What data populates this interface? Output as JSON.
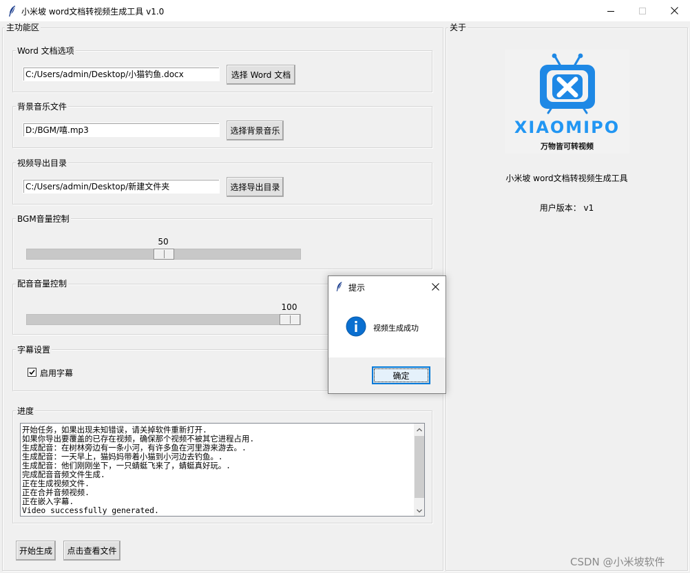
{
  "window": {
    "title": "小米坡 word文档转视频生成工具 v1.0",
    "icon": "feather-icon"
  },
  "main_panel": {
    "label": "主功能区",
    "word_section": {
      "label": "Word 文档选项",
      "path": "C:/Users/admin/Desktop/小猫钓鱼.docx",
      "button": "选择 Word 文档"
    },
    "bgm_section": {
      "label": "背景音乐文件",
      "path": "D:/BGM/嘻.mp3",
      "button": "选择背景音乐"
    },
    "output_section": {
      "label": "视频导出目录",
      "path": "C:/Users/admin/Desktop/新建文件夹",
      "button": "选择导出目录"
    },
    "bgm_volume": {
      "label": "BGM音量控制",
      "value": 50,
      "value_text": "50",
      "min": 0,
      "max": 100
    },
    "voice_volume": {
      "label": "配音音量控制",
      "value": 100,
      "value_text": "100",
      "min": 0,
      "max": 100
    },
    "subtitle_section": {
      "label": "字幕设置",
      "checkbox_label": "启用字幕",
      "checked": true
    },
    "progress_section": {
      "label": "进度",
      "lines": [
        "开始任务，如果出现未知错误，请关掉软件重新打开.",
        "如果你导出要覆盖的已存在视频，确保那个视频不被其它进程占用.",
        "生成配音：在树林旁边有一条小河，有许多鱼在河里游来游去。.",
        "生成配音：一天早上，猫妈妈带着小猫到小河边去钓鱼。.",
        "生成配音：他们刚刚坐下，一只蜻蜓飞来了，蜻蜓真好玩。.",
        "完成配音音频文件生成.",
        "正在生成视频文件.",
        "正在合并音频视频.",
        "正在嵌入字幕.",
        "Video successfully generated."
      ]
    },
    "start_button": "开始生成",
    "view_button": "点击查看文件"
  },
  "about_panel": {
    "label": "关于",
    "logo_text": "XIAOMIPO",
    "logo_tagline": "万物皆可转视频",
    "app_name": "小米坡 word文档转视频生成工具",
    "version_text": "用户版本： v1",
    "logo_color": "#2196f3"
  },
  "dialog": {
    "title": "提示",
    "message": "视频生成成功",
    "ok_button": "确定",
    "icon": "info-icon"
  },
  "watermark": "CSDN @小米坡软件",
  "colors": {
    "accent": "#0078d7",
    "info_blue": "#0a6fd0"
  }
}
